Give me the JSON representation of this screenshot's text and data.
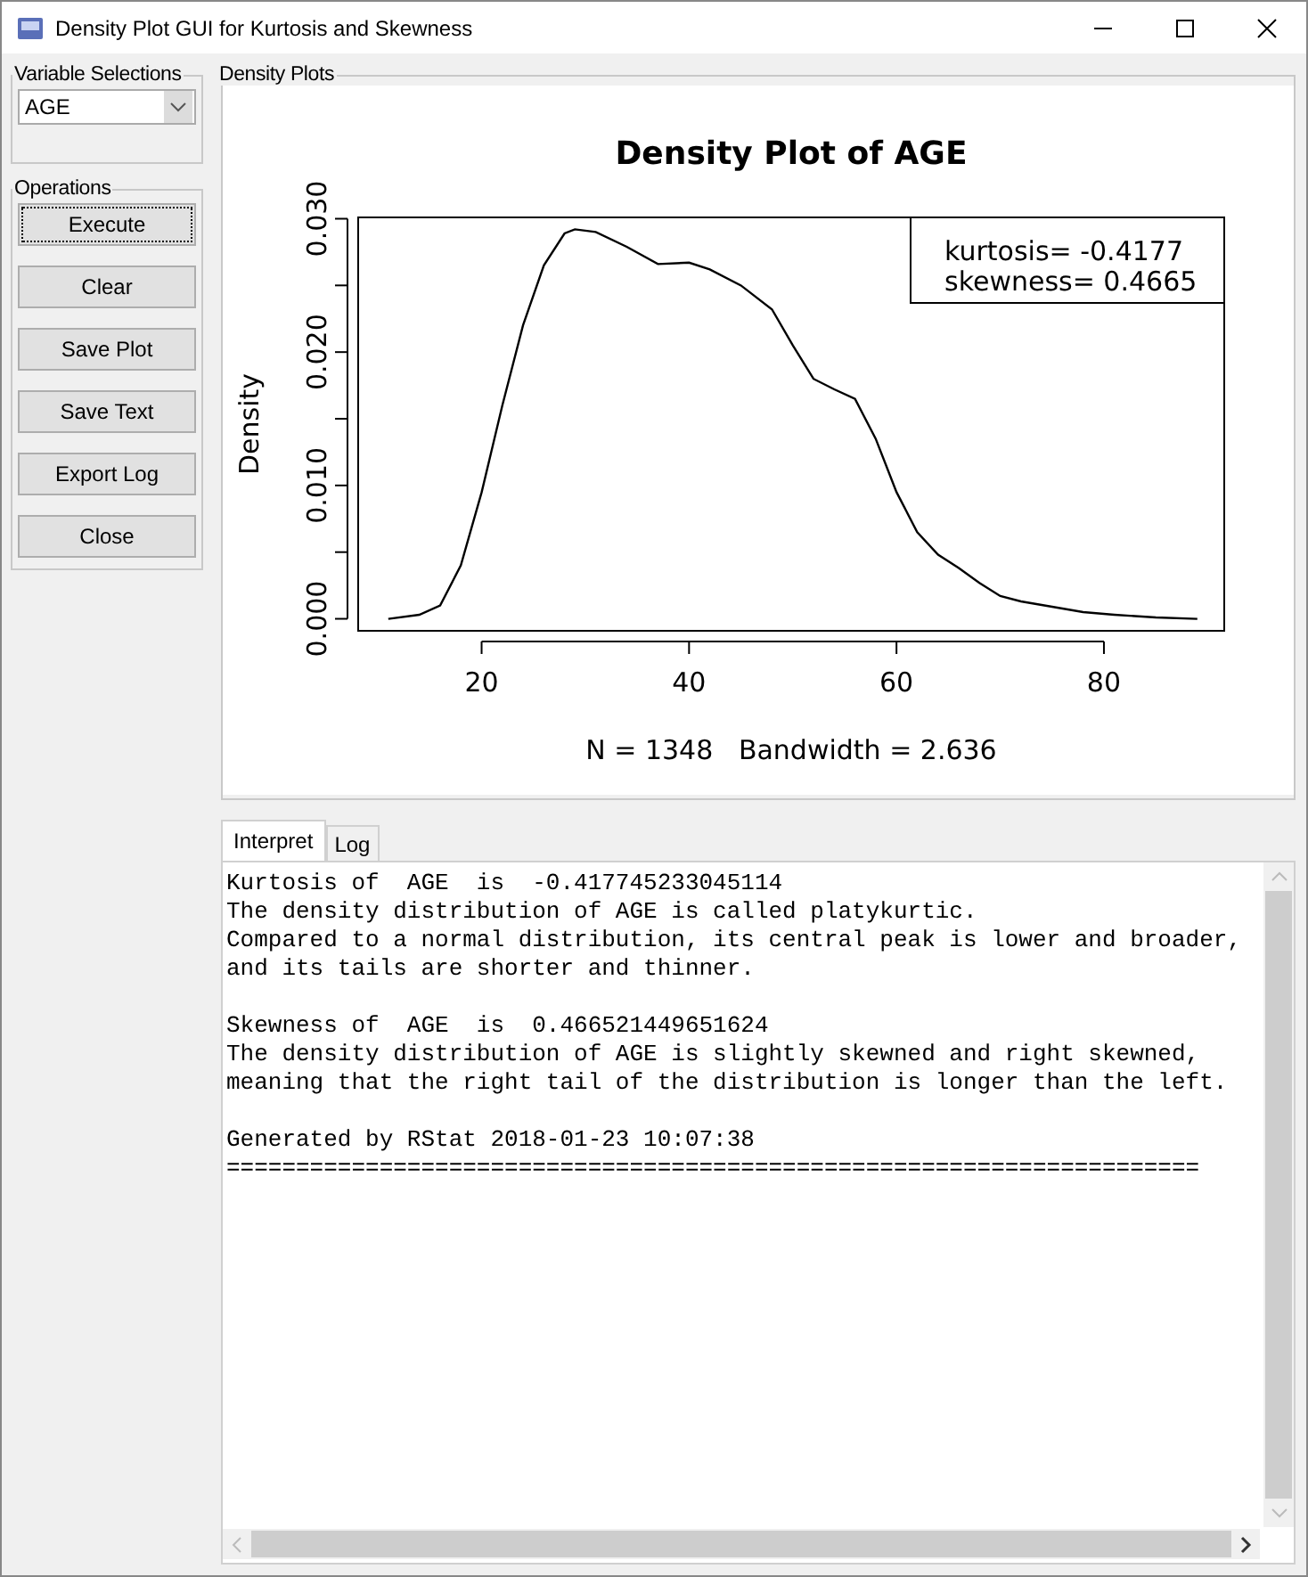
{
  "window": {
    "title": "Density Plot GUI for Kurtosis and Skewness"
  },
  "variable_selections": {
    "label": "Variable Selections",
    "value": "AGE"
  },
  "operations": {
    "label": "Operations",
    "buttons": [
      {
        "label": "Execute",
        "focused": true
      },
      {
        "label": "Clear",
        "focused": false
      },
      {
        "label": "Save Plot",
        "focused": false
      },
      {
        "label": "Save Text",
        "focused": false
      },
      {
        "label": "Export Log",
        "focused": false
      },
      {
        "label": "Close",
        "focused": false
      }
    ]
  },
  "density_plots": {
    "label": "Density Plots",
    "chart_data": {
      "type": "line",
      "title": "Density Plot of AGE",
      "xlabel": "N = 1348   Bandwidth = 2.636",
      "ylabel": "Density",
      "x": [
        11,
        14,
        16,
        18,
        20,
        22,
        24,
        26,
        28,
        29,
        31,
        34,
        37,
        40,
        42,
        45,
        48,
        50,
        52,
        54,
        56,
        58,
        60,
        62,
        64,
        66,
        68,
        70,
        72,
        75,
        78,
        81,
        85,
        89
      ],
      "series": [
        {
          "color": "#000000",
          "values": [
            0,
            0.0003,
            0.001,
            0.004,
            0.0095,
            0.016,
            0.022,
            0.0265,
            0.0289,
            0.0292,
            0.029,
            0.0279,
            0.0266,
            0.0267,
            0.0262,
            0.025,
            0.0232,
            0.0205,
            0.018,
            0.0172,
            0.0165,
            0.0135,
            0.0095,
            0.0065,
            0.0048,
            0.0038,
            0.0027,
            0.0017,
            0.0013,
            0.0009,
            0.0005,
            0.0003,
            0.0001,
            0
          ]
        }
      ],
      "xlim": [
        8.1,
        91.6
      ],
      "ylim": [
        -0.0009,
        0.0301
      ],
      "xticks": [
        20,
        40,
        60,
        80
      ],
      "yticks": [
        {
          "value": 0,
          "label": "0.000"
        },
        {
          "value": 0.01,
          "label": "0.010"
        },
        {
          "value": 0.02,
          "label": "0.020"
        },
        {
          "value": 0.03,
          "label": "0.030"
        }
      ],
      "annotations": [
        "kurtosis= -0.4177",
        "skewness= 0.4665"
      ]
    }
  },
  "tabs": [
    {
      "label": "Interpret",
      "selected": true
    },
    {
      "label": "Log",
      "selected": false
    }
  ],
  "output": {
    "paragraphs": [
      [
        "Kurtosis of  AGE  is  -0.417745233045114",
        "The density distribution of AGE is called platykurtic.",
        "Compared to a normal distribution, its central peak is lower and broader,",
        "and its tails are shorter and thinner."
      ],
      [
        "Skewness of  AGE  is  0.466521449651624",
        "The density distribution of AGE is slightly skewned and right skewned,",
        "meaning that the right tail of the distribution is longer than the left."
      ],
      [
        "Generated by RStat 2018-01-23 10:07:38",
        "======================================================================"
      ]
    ]
  }
}
